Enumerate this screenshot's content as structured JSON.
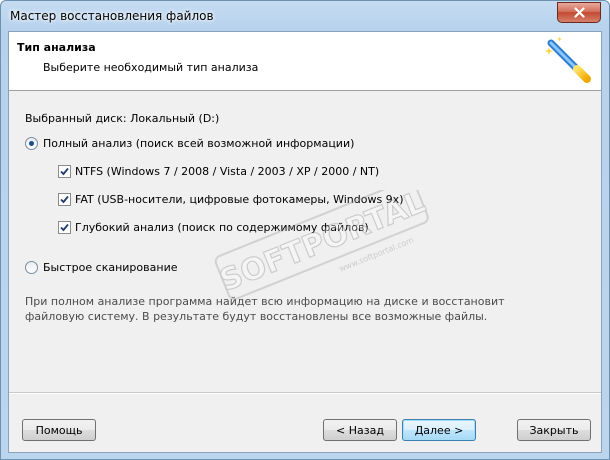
{
  "window": {
    "title": "Мастер восстановления файлов"
  },
  "header": {
    "title": "Тип анализа",
    "subtitle": "Выберите необходимый тип анализа"
  },
  "disk_label": "Выбранный диск: Локальный (D:)",
  "options": {
    "full": {
      "label": "Полный анализ (поиск всей возможной информации)",
      "selected": true,
      "sub": [
        {
          "label": "NTFS (Windows 7 / 2008 / Vista / 2003 / XP / 2000 / NT)",
          "checked": true
        },
        {
          "label": "FAT (USB-носители, цифровые фотокамеры, Windows 9x)",
          "checked": true
        },
        {
          "label": "Глубокий анализ (поиск по содержимому файлов)",
          "checked": true
        }
      ]
    },
    "quick": {
      "label": "Быстрое сканирование",
      "selected": false
    }
  },
  "info_text": "При полном анализе программа найдет всю информацию на диске и восстановит файловую систему. В результате будут восстановлены все возможные файлы.",
  "buttons": {
    "help": "Помощь",
    "back": "< Назад",
    "next": "Далее >",
    "close": "Закрыть"
  },
  "watermark": {
    "brand": "SOFTPORTAL",
    "tm": "TM",
    "url": "www.softportal.com"
  },
  "icons": {
    "close": "close-icon",
    "wizard": "magic-wand-icon"
  },
  "colors": {
    "radio_dot": "#1c4f86",
    "default_button_border": "#3c7fb1",
    "titlebar": "#b7d1ec"
  }
}
